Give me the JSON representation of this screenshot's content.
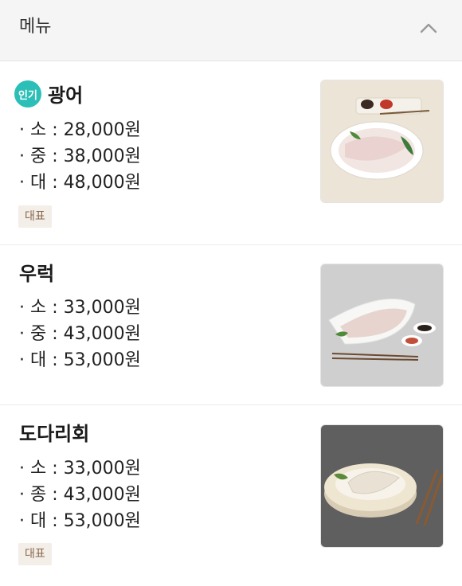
{
  "header": {
    "title": "메뉴",
    "toggle_icon": "chevron-up-icon"
  },
  "menu": [
    {
      "name": "광어",
      "badge": "인기",
      "prices": [
        "· 소 : 28,000원",
        "· 중 : 38,000원",
        "· 대 : 48,000원"
      ],
      "tag": "대표",
      "image": "flounder-sashimi-plate"
    },
    {
      "name": "우럭",
      "prices": [
        "· 소 : 33,000원",
        "· 중 : 43,000원",
        "· 대 : 53,000원"
      ],
      "image": "rockfish-sashimi-plate"
    },
    {
      "name": "도다리회",
      "prices": [
        "· 소 : 33,000원",
        "· 종 : 43,000원",
        "· 대 : 53,000원"
      ],
      "tag": "대표",
      "image": "halibut-sashimi-plate"
    }
  ],
  "colors": {
    "badge": "#2bbfb8",
    "tag_bg": "#f3eee8",
    "tag_text": "#8a6a4e"
  }
}
